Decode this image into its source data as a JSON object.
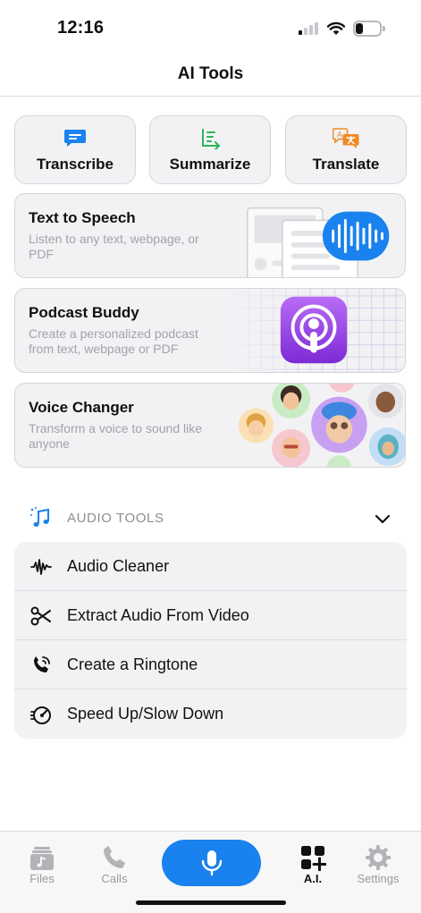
{
  "status": {
    "time": "12:16"
  },
  "header": {
    "title": "AI Tools"
  },
  "quick_tools": [
    {
      "label": "Transcribe",
      "icon": "chat-bubble-icon",
      "color": "#1a82ee"
    },
    {
      "label": "Summarize",
      "icon": "summary-list-icon",
      "color": "#2fb35a"
    },
    {
      "label": "Translate",
      "icon": "translate-icon",
      "color": "#f08a24"
    }
  ],
  "feature_cards": [
    {
      "title": "Text to Speech",
      "description": "Listen to any text, webpage, or PDF",
      "art": "document-waveform-art"
    },
    {
      "title": "Podcast Buddy",
      "description": "Create a personalized podcast from text, webpage or PDF",
      "art": "podcast-app-icon"
    },
    {
      "title": "Voice Changer",
      "description": "Transform a voice to sound like anyone",
      "art": "avatar-collage"
    }
  ],
  "audio_section": {
    "label": "AUDIO TOOLS",
    "icon": "music-note-icon",
    "items": [
      {
        "label": "Audio Cleaner",
        "icon": "waveform-icon"
      },
      {
        "label": "Extract Audio From Video",
        "icon": "scissors-icon"
      },
      {
        "label": "Create a Ringtone",
        "icon": "phone-ringing-icon"
      },
      {
        "label": "Speed Up/Slow Down",
        "icon": "speed-icon"
      }
    ]
  },
  "tab_bar": {
    "tabs": [
      {
        "label": "Files",
        "icon": "files-icon"
      },
      {
        "label": "Calls",
        "icon": "phone-icon"
      },
      {
        "label": "A.I.",
        "icon": "apps-plus-icon",
        "active": true
      },
      {
        "label": "Settings",
        "icon": "gear-icon"
      }
    ],
    "record_icon": "microphone-icon",
    "accent": "#1a82ee"
  }
}
